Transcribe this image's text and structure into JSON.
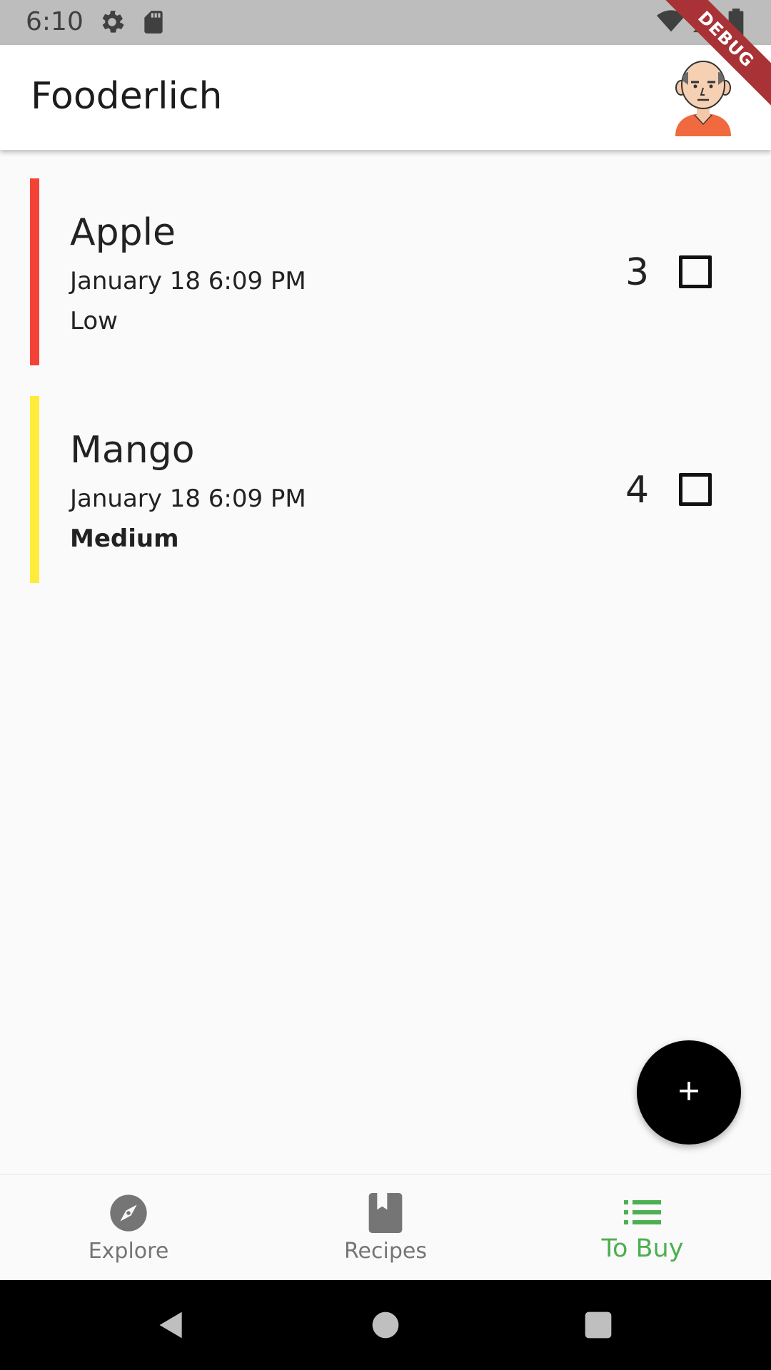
{
  "status_bar": {
    "time": "6:10",
    "icons": [
      "gear-icon",
      "sd-card-icon",
      "wifi-icon",
      "signal-icon",
      "battery-icon"
    ]
  },
  "debug_banner": "DEBUG",
  "app_bar": {
    "title": "Fooderlich",
    "avatar_icon": "profile-avatar"
  },
  "grocery_items": [
    {
      "name": "Apple",
      "date": "January 18 6:09 PM",
      "importance": "Low",
      "quantity": "3",
      "checked": false,
      "color": "#f44336"
    },
    {
      "name": "Mango",
      "date": "January 18 6:09 PM",
      "importance": "Medium",
      "quantity": "4",
      "checked": false,
      "color": "#ffeb3b"
    }
  ],
  "fab": {
    "icon": "add-icon"
  },
  "bottom_nav": {
    "items": [
      {
        "label": "Explore",
        "icon": "compass-icon",
        "selected": false
      },
      {
        "label": "Recipes",
        "icon": "book-icon",
        "selected": false
      },
      {
        "label": "To Buy",
        "icon": "list-icon",
        "selected": true
      }
    ],
    "selected_color": "#4caf50",
    "unselected_color": "#757575"
  },
  "system_nav": {
    "icons": [
      "back-icon",
      "home-icon",
      "recents-icon"
    ]
  }
}
